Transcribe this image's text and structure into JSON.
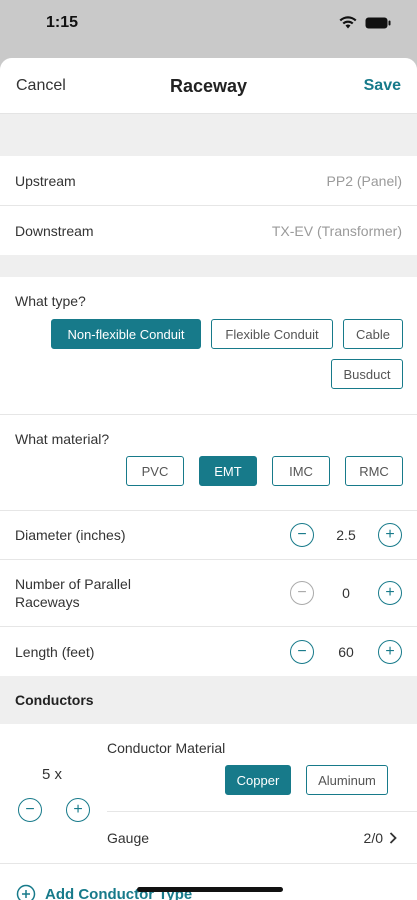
{
  "status": {
    "time": "1:15"
  },
  "nav": {
    "cancel": "Cancel",
    "title": "Raceway",
    "save": "Save"
  },
  "endpoints": [
    {
      "label": "Upstream",
      "value": "PP2 (Panel)"
    },
    {
      "label": "Downstream",
      "value": "TX-EV (Transformer)"
    }
  ],
  "type_section": {
    "title": "What type?",
    "options": [
      "Non-flexible Conduit",
      "Flexible Conduit",
      "Cable",
      "Busduct"
    ],
    "selected": "Non-flexible Conduit"
  },
  "material_section": {
    "title": "What material?",
    "options": [
      "PVC",
      "EMT",
      "IMC",
      "RMC"
    ],
    "selected": "EMT"
  },
  "steppers": [
    {
      "label": "Diameter (inches)",
      "value": "2.5"
    },
    {
      "label": "Number of Parallel Raceways",
      "value": "0"
    },
    {
      "label": "Length (feet)",
      "value": "60"
    }
  ],
  "conductors": {
    "header": "Conductors",
    "count": "5 x",
    "material_title": "Conductor Material",
    "materials": [
      "Copper",
      "Aluminum"
    ],
    "selected_material": "Copper",
    "gauge_label": "Gauge",
    "gauge_value": "2/0",
    "add_label": "Add Conductor Type"
  },
  "colors": {
    "accent": "#177a8a",
    "background": "#efefef"
  },
  "icons": [
    "wifi-icon",
    "battery-icon",
    "minus-circle-icon",
    "plus-circle-icon",
    "chevron-right-icon"
  ]
}
